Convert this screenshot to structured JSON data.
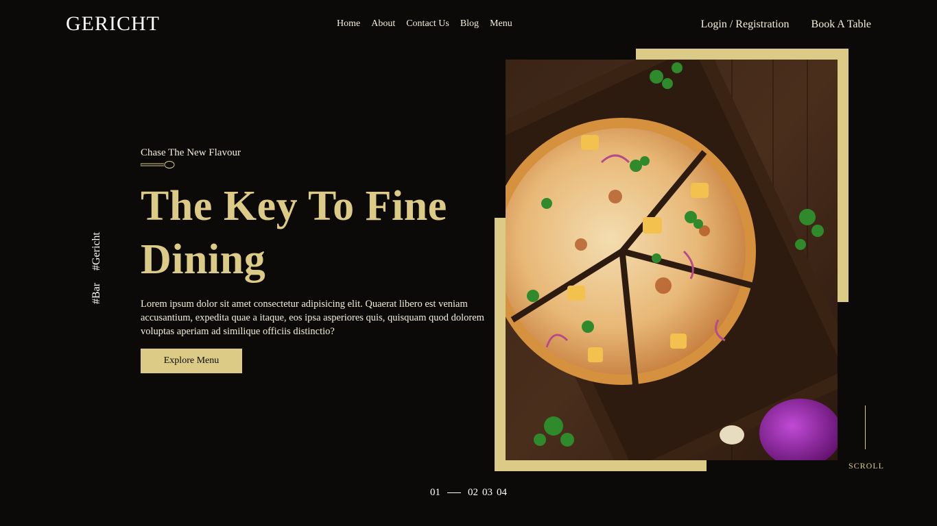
{
  "brand": {
    "logo": "GERICHT"
  },
  "nav": {
    "items": [
      "Home",
      "About",
      "Contact Us",
      "Blog",
      "Menu"
    ],
    "login": "Login / Registration",
    "book": "Book A Table"
  },
  "side_tags": [
    "#Bar",
    "#Gericht"
  ],
  "hero": {
    "subtitle": "Chase The New Flavour",
    "title_line1": "The Key To Fine",
    "title_line2": "Dining",
    "description": "Lorem ipsum dolor sit amet consectetur adipisicing elit. Quaerat libero est veniam accusantium, expedita quae a itaque, eos ipsa asperiores quis, quisquam quod dolorem voluptas aperiam ad similique officiis distinctio?",
    "cta": "Explore Menu"
  },
  "image": {
    "subject": "pizza-on-wooden-board"
  },
  "scroll": {
    "label": "SCROLL"
  },
  "pager": {
    "active": "01",
    "pages": [
      "02",
      "03",
      "04"
    ]
  },
  "colors": {
    "background": "#0c0a08",
    "accent": "#dcca87",
    "text": "#f5efdb"
  }
}
